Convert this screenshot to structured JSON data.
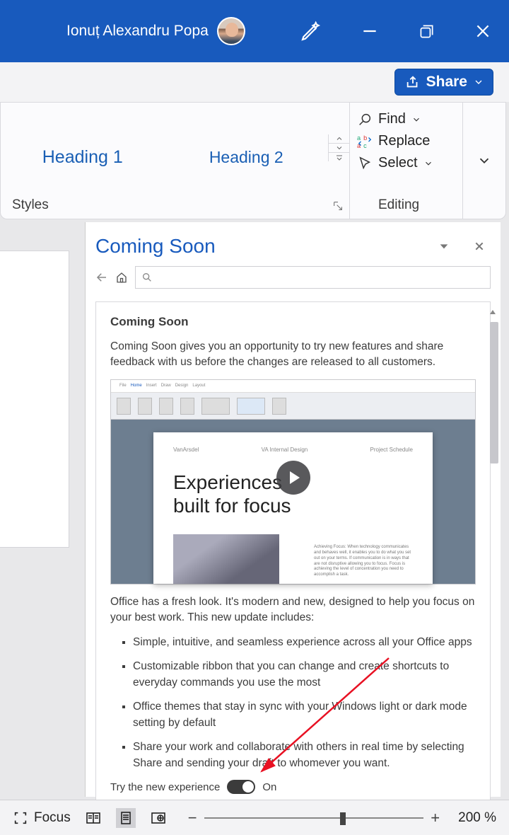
{
  "titlebar": {
    "user_name": "Ionuț Alexandru Popa"
  },
  "sharebar": {
    "share_label": "Share"
  },
  "ribbon": {
    "styles": {
      "heading1": "Heading 1",
      "heading2": "Heading 2",
      "group_label": "Styles"
    },
    "editing": {
      "find": "Find",
      "replace": "Replace",
      "select": "Select",
      "group_label": "Editing"
    }
  },
  "pane": {
    "title": "Coming Soon",
    "card_title": "Coming Soon",
    "intro": "Coming Soon gives you an opportunity to try new features and share feedback with us before the changes are released to all customers.",
    "video": {
      "heading_l1": "Experiences",
      "heading_l2": "built for focus",
      "meta_left": "VanArsdel",
      "meta_mid": "VA Internal Design",
      "meta_right": "Project Schedule"
    },
    "desc": "Office has a fresh look. It's modern and new, designed to help you focus on your best work. This new update includes:",
    "features": [
      "Simple, intuitive, and seamless experience across all your Office apps",
      "Customizable ribbon that you can change and create shortcuts to everyday commands you use the most",
      "Office themes that stay in sync with your Windows light or dark mode setting by default",
      "Share your work and collaborate with others in real time by selecting Share and sending your draft to whomever you want."
    ],
    "toggle_label": "Try the new experience",
    "toggle_state": "On"
  },
  "status": {
    "focus": "Focus",
    "zoom": "200 %"
  }
}
